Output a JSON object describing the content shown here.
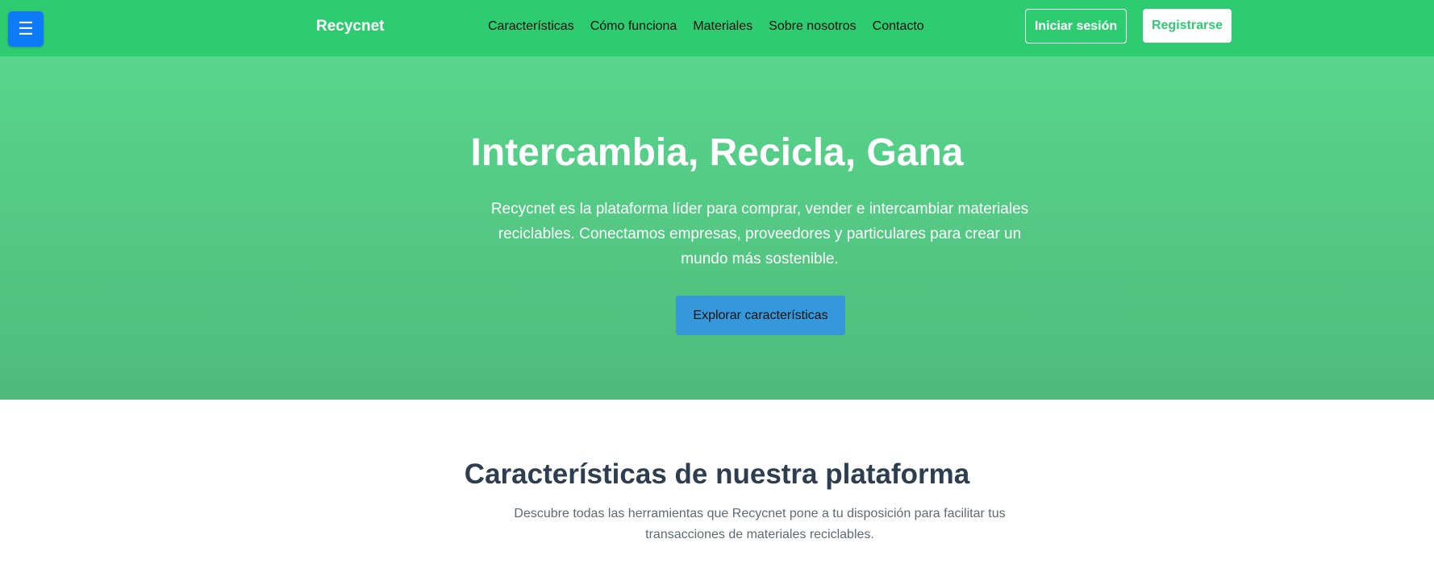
{
  "header": {
    "menu_icon": "☰",
    "brand": "Recycnet",
    "nav": [
      {
        "label": "Características"
      },
      {
        "label": "Cómo funciona"
      },
      {
        "label": "Materiales"
      },
      {
        "label": "Sobre nosotros"
      },
      {
        "label": "Contacto"
      }
    ],
    "login_label": "Iniciar sesión",
    "register_label": "Registrarse"
  },
  "hero": {
    "title": "Intercambia, Recicla, Gana",
    "description": "Recycnet es la plataforma líder para comprar, vender e intercambiar materiales reciclables. Conectamos empresas, proveedores y particulares para crear un mundo más sostenible.",
    "cta_label": "Explorar características"
  },
  "features": {
    "title": "Características de nuestra plataforma",
    "description": "Descubre todas las herramientas que Recycnet pone a tu disposición para facilitar tus transacciones de materiales reciclables."
  },
  "colors": {
    "brand_green": "#2ecc71",
    "menu_blue": "#0d7bf7",
    "cta_blue": "#3498db",
    "heading_dark": "#2c3e50"
  },
  "icons": {
    "menu": "hamburger-menu-icon"
  }
}
